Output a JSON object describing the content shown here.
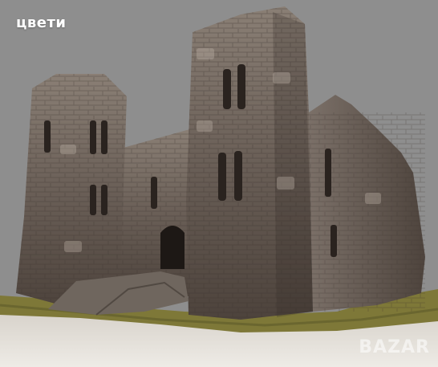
{
  "caption": "цвети",
  "watermark": "BAZAR",
  "colors": {
    "background": "#8e8e8e",
    "stone_dark": "#4a4039",
    "stone_mid": "#6d625a",
    "stone_light": "#a59a8f",
    "moss": "#7f7a3a",
    "base": "#d9d4cd"
  }
}
